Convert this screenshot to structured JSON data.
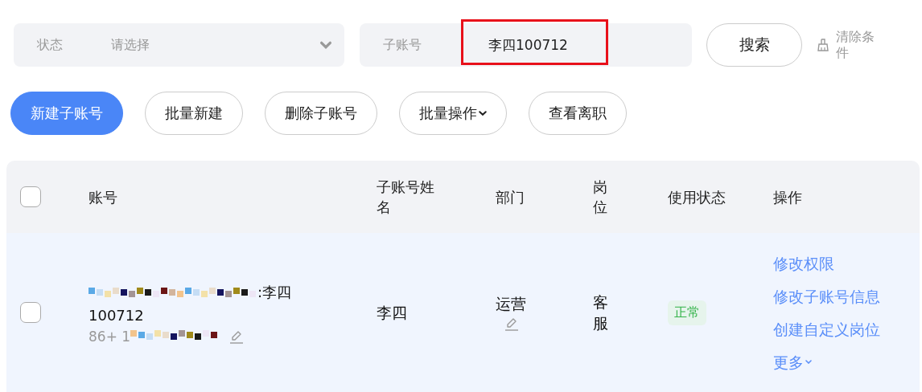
{
  "filters": {
    "status": {
      "label": "状态",
      "placeholder": "请选择"
    },
    "account": {
      "label": "子账号",
      "value": "李四100712",
      "highlighted": true
    },
    "search_button": "搜索",
    "clear_link": "清除条件"
  },
  "toolbar": [
    {
      "label": "新建子账号",
      "primary": true,
      "dropdown": false
    },
    {
      "label": "批量新建",
      "primary": false,
      "dropdown": false
    },
    {
      "label": "删除子账号",
      "primary": false,
      "dropdown": false
    },
    {
      "label": "批量操作",
      "primary": false,
      "dropdown": true
    },
    {
      "label": "查看离职",
      "primary": false,
      "dropdown": false
    }
  ],
  "table": {
    "select_all": {
      "checked": false
    },
    "columns": [
      "账号",
      "子账号姓名",
      "部门",
      "岗位",
      "使用状态",
      "操作"
    ],
    "rows": [
      {
        "checked": false,
        "account": ":李四100712",
        "phone_prefix": "86+ 1",
        "name": "李四",
        "department": "运营",
        "post": "客服",
        "status": "正常",
        "actions": [
          "修改权限",
          "修改子账号信息",
          "创建自定义岗位"
        ],
        "more": "更多"
      }
    ]
  }
}
